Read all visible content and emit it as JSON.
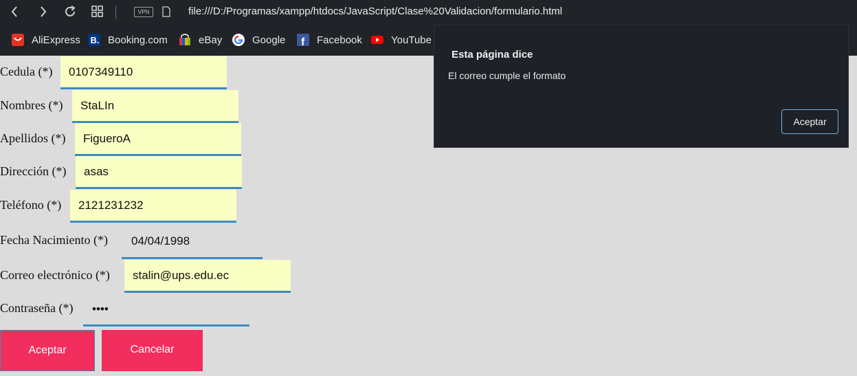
{
  "browser": {
    "url": "file:///D:/Programas/xampp/htdocs/JavaScript/Clase%20Validacion/formulario.html",
    "vpn_label": "VPN",
    "bookmarks": [
      {
        "label": "AliExpress",
        "icon": "aliexpress-icon",
        "color": "#e43225"
      },
      {
        "label": "Booking.com",
        "icon": "booking-icon",
        "color": "#003580"
      },
      {
        "label": "eBay",
        "icon": "ebay-icon",
        "color": "#e53238"
      },
      {
        "label": "Google",
        "icon": "google-icon",
        "color": "#4285f4"
      },
      {
        "label": "Facebook",
        "icon": "facebook-icon",
        "color": "#3b5998"
      },
      {
        "label": "YouTube",
        "icon": "youtube-icon",
        "color": "#ff0000"
      }
    ]
  },
  "form": {
    "cedula": {
      "label": "Cedula (*)",
      "value": "0107349110"
    },
    "nombres": {
      "label": "Nombres (*)",
      "value": "StaLIn"
    },
    "apellidos": {
      "label": "Apellidos (*)",
      "value": "FigueroA"
    },
    "direccion": {
      "label": "Dirección (*)",
      "value": "asas"
    },
    "telefono": {
      "label": "Teléfono (*)",
      "value": "2121231232"
    },
    "fecha": {
      "label": "Fecha Nacimiento (*)",
      "value": "04/04/1998"
    },
    "correo": {
      "label": "Correo electrónico (*)",
      "value": "stalin@ups.edu.ec"
    },
    "contrasena": {
      "label": "Contraseña (*)",
      "value": "••••"
    },
    "accept_label": "Aceptar",
    "cancel_label": "Cancelar"
  },
  "dialog": {
    "title": "Esta página dice",
    "message": "El correo cumple el formato",
    "button_label": "Aceptar"
  },
  "colors": {
    "field_bg": "#faffc3",
    "field_border": "#3b8ac4",
    "button_bg": "#f22e5e",
    "dialog_bg": "#1e2127"
  }
}
